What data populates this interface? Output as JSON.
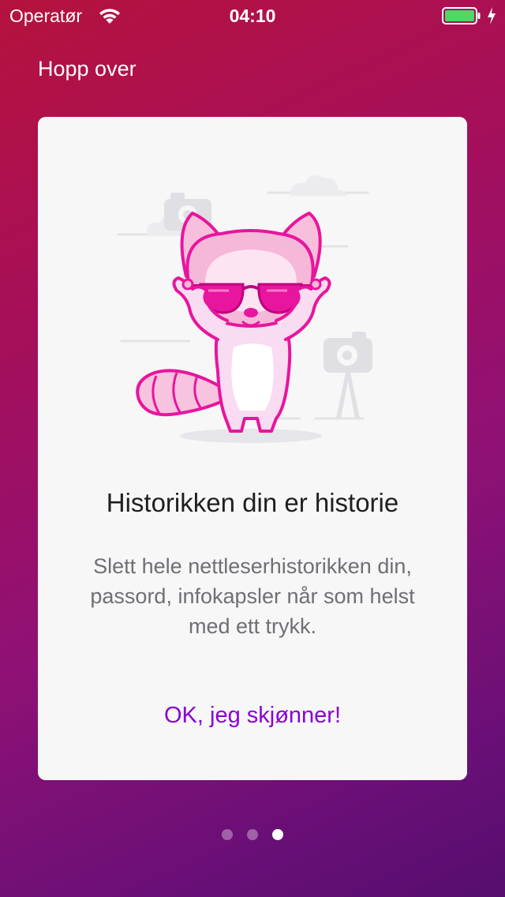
{
  "status_bar": {
    "carrier": "Operatør",
    "time": "04:10",
    "battery_color": "#4cd964"
  },
  "skip_label": "Hopp over",
  "card": {
    "title": "Historikken din er historie",
    "description": "Slett hele nettleserhistorikken din, passord, infokapsler når som helst med ett trykk.",
    "ok_label": "OK, jeg skjønner!"
  },
  "pagination": {
    "total": 3,
    "active_index": 2
  },
  "colors": {
    "accent": "#8a00d4",
    "illustration_pink": "#e8159e"
  }
}
